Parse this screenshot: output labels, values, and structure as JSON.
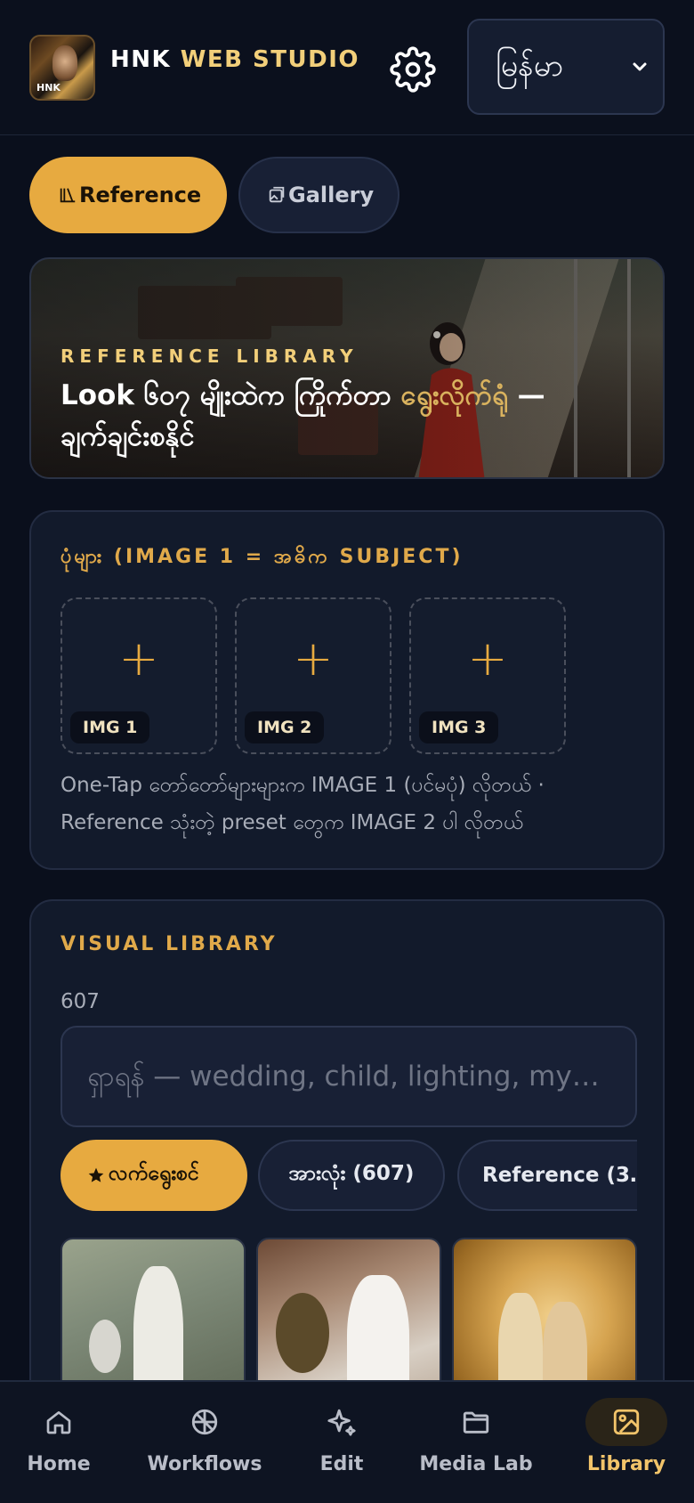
{
  "header": {
    "brand_part1": "HNK",
    "brand_part2": "WEB STUDIO",
    "language_value": "မြန်မာ"
  },
  "tabs": [
    {
      "label": "Reference",
      "active": true
    },
    {
      "label": "Gallery",
      "active": false
    }
  ],
  "hero": {
    "eyebrow": "REFERENCE LIBRARY",
    "title_start": "Look ၆၀၇ မျိုးထဲက ကြိုက်တာ ",
    "title_highlight": "ရွေးလိုက်ရုံ",
    "title_end": " — ချက်ချင်းစနိုင်"
  },
  "images_panel": {
    "heading": "ပုံများ (IMAGE 1 = အဓိက SUBJECT)",
    "slots": [
      "IMG 1",
      "IMG 2",
      "IMG 3"
    ],
    "plus": "+",
    "note": "One-Tap တော်တော်များများက IMAGE 1 (ပင်မပုံ) လိုတယ် · Reference သုံးတဲ့ preset တွေက IMAGE 2 ပါ လိုတယ်"
  },
  "library": {
    "heading": "VISUAL LIBRARY",
    "count": "607",
    "search_placeholder": "ရှာရန် — wedding, child, lighting, my…",
    "chips": [
      {
        "label": "လက်ရွေးစင်",
        "icon": "star-icon",
        "active": true
      },
      {
        "label": "အားလုံး (607)",
        "active": false
      },
      {
        "label": "Reference (3…",
        "active": false
      }
    ]
  },
  "nav": [
    {
      "label": "Home",
      "icon": "home-icon",
      "active": false
    },
    {
      "label": "Workflows",
      "icon": "workflows-icon",
      "active": false
    },
    {
      "label": "Edit",
      "icon": "sparkle-icon",
      "active": false
    },
    {
      "label": "Media Lab",
      "icon": "folder-icon",
      "active": false
    },
    {
      "label": "Library",
      "icon": "image-icon",
      "active": true
    }
  ],
  "colors": {
    "accent": "#e7aa40",
    "gold_text": "#f2cf7a",
    "background": "#0a0f1c",
    "panel": "#121a2b"
  }
}
